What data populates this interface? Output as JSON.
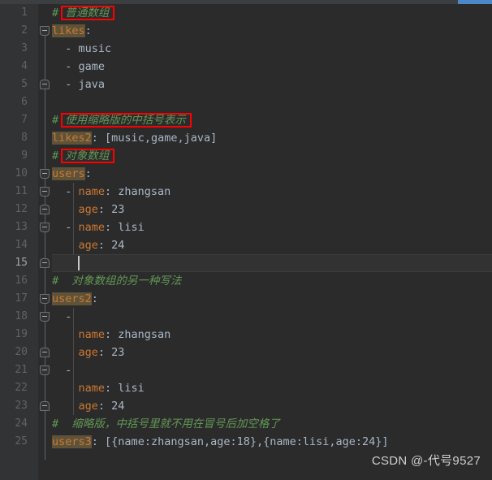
{
  "editor": {
    "title": "YAML editor",
    "theme": "darcula",
    "colors": {
      "background": "#2b2b2b",
      "gutter_background": "#313335",
      "line_number": "#606366",
      "line_number_current": "#a4a3a3",
      "comment": "#629755",
      "key": "#cc7832",
      "key_highlight_background": "#5e5339",
      "punctuation": "#a9b7c6",
      "value": "#a9b7c6",
      "annotation_box": "#fe0000",
      "scrollbar_thumb": "#4a88c7",
      "caret": "#c8c8c8"
    },
    "current_line": 15,
    "caret": {
      "line": 15,
      "column": 5
    },
    "scrollbar": {
      "orientation": "horizontal",
      "position": "top",
      "thumb_label": "scroll-thumb"
    }
  },
  "lines": [
    {
      "n": 1,
      "indent": 0,
      "type": "comment",
      "hash": "#",
      "text": "普通数组",
      "boxed": true
    },
    {
      "n": 2,
      "indent": 0,
      "type": "mapping-highlight",
      "key": "likes",
      "colon": ":",
      "value": ""
    },
    {
      "n": 3,
      "indent": 2,
      "type": "seq",
      "dash": "-",
      "value": "music"
    },
    {
      "n": 4,
      "indent": 2,
      "type": "seq",
      "dash": "-",
      "value": "game"
    },
    {
      "n": 5,
      "indent": 2,
      "type": "seq",
      "dash": "-",
      "value": "java"
    },
    {
      "n": 6,
      "indent": 0,
      "type": "blank"
    },
    {
      "n": 7,
      "indent": 0,
      "type": "comment",
      "hash": "#",
      "text": "使用缩略版的中括号表示",
      "boxed": true
    },
    {
      "n": 8,
      "indent": 0,
      "type": "mapping-highlight",
      "key": "likes2",
      "colon": ":",
      "value": " [music,game,java]"
    },
    {
      "n": 9,
      "indent": 0,
      "type": "comment",
      "hash": "#",
      "text": "对象数组",
      "boxed": true
    },
    {
      "n": 10,
      "indent": 0,
      "type": "mapping-highlight",
      "key": "users",
      "colon": ":",
      "value": ""
    },
    {
      "n": 11,
      "indent": 2,
      "type": "seq-map",
      "dash": "-",
      "key": "name",
      "colon": ":",
      "value": " zhangsan"
    },
    {
      "n": 12,
      "indent": 4,
      "type": "map",
      "key": "age",
      "colon": ":",
      "value": " 23"
    },
    {
      "n": 13,
      "indent": 2,
      "type": "seq-map",
      "dash": "-",
      "key": "name",
      "colon": ":",
      "value": " lisi"
    },
    {
      "n": 14,
      "indent": 4,
      "type": "map",
      "key": "age",
      "colon": ":",
      "value": " 24"
    },
    {
      "n": 15,
      "indent": 4,
      "type": "blank-current"
    },
    {
      "n": 16,
      "indent": 0,
      "type": "comment",
      "hash": "#",
      "text": " 对象数组的另一种写法",
      "boxed": false
    },
    {
      "n": 17,
      "indent": 0,
      "type": "mapping-highlight",
      "key": "users2",
      "colon": ":",
      "value": ""
    },
    {
      "n": 18,
      "indent": 2,
      "type": "seq",
      "dash": "-",
      "value": ""
    },
    {
      "n": 19,
      "indent": 4,
      "type": "map",
      "key": "name",
      "colon": ":",
      "value": " zhangsan"
    },
    {
      "n": 20,
      "indent": 4,
      "type": "map",
      "key": "age",
      "colon": ":",
      "value": " 23"
    },
    {
      "n": 21,
      "indent": 2,
      "type": "seq",
      "dash": "-",
      "value": ""
    },
    {
      "n": 22,
      "indent": 4,
      "type": "map",
      "key": "name",
      "colon": ":",
      "value": " lisi"
    },
    {
      "n": 23,
      "indent": 4,
      "type": "map",
      "key": "age",
      "colon": ":",
      "value": " 24"
    },
    {
      "n": 24,
      "indent": 0,
      "type": "comment",
      "hash": "#",
      "text": " 缩略版，中括号里就不用在冒号后加空格了",
      "boxed": false
    },
    {
      "n": 25,
      "indent": 0,
      "type": "mapping-highlight",
      "key": "users3",
      "colon": ":",
      "value": " [{name:zhangsan,age:18},{name:lisi,age:24}]"
    }
  ],
  "fold_markers": [
    {
      "name": "fold-likes-start",
      "line": 2,
      "state": "expanded",
      "kind": "start"
    },
    {
      "name": "fold-likes-end",
      "line": 5,
      "state": "expanded",
      "kind": "end"
    },
    {
      "name": "fold-users-start",
      "line": 10,
      "state": "expanded",
      "kind": "start"
    },
    {
      "name": "fold-user1-start",
      "line": 11,
      "state": "expanded",
      "kind": "start"
    },
    {
      "name": "fold-user1-end",
      "line": 12,
      "state": "expanded",
      "kind": "end"
    },
    {
      "name": "fold-user2-start",
      "line": 13,
      "state": "expanded",
      "kind": "start"
    },
    {
      "name": "fold-user2-end",
      "line": 15,
      "state": "expanded",
      "kind": "end"
    },
    {
      "name": "fold-users2-start",
      "line": 17,
      "state": "expanded",
      "kind": "start"
    },
    {
      "name": "fold-u2a-start",
      "line": 18,
      "state": "expanded",
      "kind": "start"
    },
    {
      "name": "fold-u2a-end",
      "line": 20,
      "state": "expanded",
      "kind": "end"
    },
    {
      "name": "fold-u2b-start",
      "line": 21,
      "state": "expanded",
      "kind": "start"
    },
    {
      "name": "fold-u2b-end",
      "line": 23,
      "state": "expanded",
      "kind": "end"
    }
  ],
  "annotations": [
    {
      "name": "annotation-box-line1",
      "line": 1,
      "label": "普通数组"
    },
    {
      "name": "annotation-box-line7",
      "line": 7,
      "label": "使用缩略版的中括号表示"
    },
    {
      "name": "annotation-box-line9",
      "line": 9,
      "label": "对象数组"
    }
  ],
  "watermark": {
    "text": "CSDN @-代号9527"
  }
}
